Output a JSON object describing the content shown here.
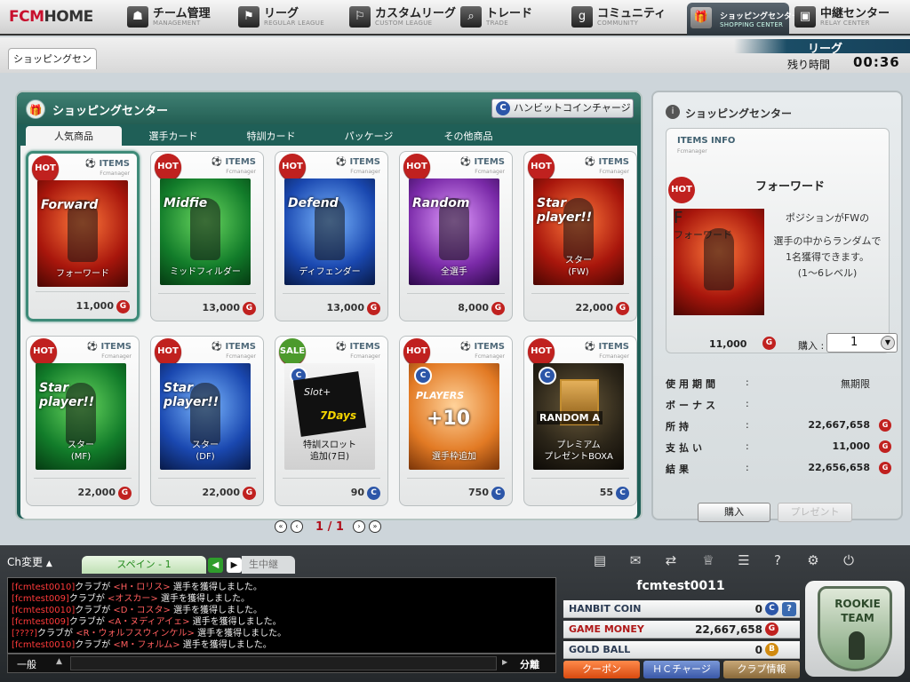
{
  "nav": {
    "logo_hl": "FCM",
    "logo_rest": "HOME",
    "items": [
      {
        "label": "チーム管理",
        "sub": "MANAGEMENT",
        "icon": "person-icon"
      },
      {
        "label": "リーグ",
        "sub": "REGULAR LEAGUE",
        "icon": "flag-icon"
      },
      {
        "label": "カスタムリーグ",
        "sub": "CUSTOM LEAGUE",
        "icon": "flag-icon"
      },
      {
        "label": "トレード",
        "sub": "TRADE",
        "icon": "search-icon"
      },
      {
        "label": "コミュニティ",
        "sub": "COMMUNITY",
        "icon": "community-icon"
      },
      {
        "label": "ショッピングセンター",
        "sub": "SHOPPING CENTER",
        "icon": "gift-icon"
      },
      {
        "label": "中継センター",
        "sub": "RELAY CENTER",
        "icon": "tv-icon"
      }
    ]
  },
  "subbar": {
    "crumb": "ショッピングセンター",
    "league": "リーグ",
    "time_label": "残り時間",
    "time_value": "00:36"
  },
  "shop": {
    "title": "ショッピングセンター",
    "charge_label": "ハンビットコインチャージ",
    "tabs": [
      "人気商品",
      "選手カード",
      "特訓カード",
      "パッケージ",
      "その他商品"
    ],
    "items_label": "ITEMS",
    "items_sub": "Fcmanager",
    "cards": [
      {
        "badge": "HOT",
        "name": "フォーワード",
        "big": "Forward",
        "price": "11,000",
        "curr": "G",
        "art": "red"
      },
      {
        "badge": "HOT",
        "name": "ミッドフィルダー",
        "big": "Midfie",
        "price": "13,000",
        "curr": "G",
        "art": "green"
      },
      {
        "badge": "HOT",
        "name": "ディフェンダー",
        "big": "Defend",
        "price": "13,000",
        "curr": "G",
        "art": "blue"
      },
      {
        "badge": "HOT",
        "name": "全選手",
        "big": "Random",
        "price": "8,000",
        "curr": "G",
        "art": "purple"
      },
      {
        "badge": "HOT",
        "name": "スター\n(FW)",
        "big": "Star player!!",
        "price": "22,000",
        "curr": "G",
        "art": "red"
      },
      {
        "badge": "HOT",
        "name": "スター\n(MF)",
        "big": "Star player!!",
        "price": "22,000",
        "curr": "G",
        "art": "green"
      },
      {
        "badge": "HOT",
        "name": "スター\n(DF)",
        "big": "Star player!!",
        "price": "22,000",
        "curr": "G",
        "art": "blue"
      },
      {
        "badge": "SALE",
        "name": "特訓スロット\n追加(7日)",
        "big": "Slot+",
        "days": "7Days",
        "price": "90",
        "curr": "C",
        "art": "slot"
      },
      {
        "badge": "HOT",
        "name": "選手枠追加",
        "big": "+10",
        "players": "PLAYERS",
        "price": "750",
        "curr": "C",
        "art": "gold"
      },
      {
        "badge": "HOT",
        "name": "プレミアム\nプレゼントBOXA",
        "big": "RANDOM A",
        "price": "55",
        "curr": "C",
        "art": "dark"
      }
    ],
    "page": "1 / 1"
  },
  "info": {
    "title": "ショッピングセンター",
    "items_info": "ITEMS INFO",
    "items_info_sub": "Fcmanager",
    "badge": "HOT",
    "name": "フォーワード",
    "art_name": "フォーワード",
    "desc1": "ポジションがFWの",
    "desc2": "選手の中からランダムで",
    "desc3": "1名獲得できます。",
    "desc4": "(1〜6レベル)",
    "price": "11,000",
    "qty_label": "購入 :",
    "qty_value": "1",
    "rows": [
      {
        "k": "使用期間",
        "v": "無期限"
      },
      {
        "k": "ボーナス",
        "v": ""
      },
      {
        "k": "所持",
        "v": "22,667,658"
      },
      {
        "k": "支払い",
        "v": "11,000"
      },
      {
        "k": "結果",
        "v": "22,656,658"
      }
    ],
    "buy_label": "購入",
    "present_label": "プレゼント"
  },
  "bottom": {
    "ch_change": "Ch変更",
    "chat_tab": "スペイン - 1",
    "live_tab": "生中継",
    "chat_lines": [
      {
        "who": "[fcmtest0010]",
        "club": "クラブが",
        "hl": "<H・ロリス>",
        "txt": "選手を獲得しました。"
      },
      {
        "who": "[fcmtest009]",
        "club": "クラブが",
        "hl": "<オスカー>",
        "txt": "選手を獲得しました。"
      },
      {
        "who": "[fcmtest0010]",
        "club": "クラブが",
        "hl": "<D・コスタ>",
        "txt": "選手を獲得しました。"
      },
      {
        "who": "[fcmtest009]",
        "club": "クラブが",
        "hl": "<A・ヌディアイェ>",
        "txt": "選手を獲得しました。"
      },
      {
        "who": "[????]",
        "club": "クラブが",
        "hl": "<R・ウォルフスウィンケル>",
        "txt": "選手を獲得しました。"
      },
      {
        "who": "[fcmtest0010]",
        "club": "クラブが",
        "hl": "<M・フォルム>",
        "txt": "選手を獲得しました。"
      }
    ],
    "chat_mode": "一般",
    "chat_send": "分離",
    "username": "fcmtest0011",
    "stats": [
      {
        "k": "HANBIT COIN",
        "v": "0",
        "ci": "C",
        "color": "#2c56a8"
      },
      {
        "k": "GAME MONEY",
        "v": "22,667,658",
        "ci": "G",
        "color": "#c0211f"
      },
      {
        "k": "GOLD BALL",
        "v": "0",
        "ci": "B",
        "color": "#d08a10"
      }
    ],
    "coupon": "クーポン",
    "hc_charge": "ＨＣチャージ",
    "club_info": "クラブ情報",
    "rookie1": "ROOKIE",
    "rookie2": "TEAM"
  }
}
